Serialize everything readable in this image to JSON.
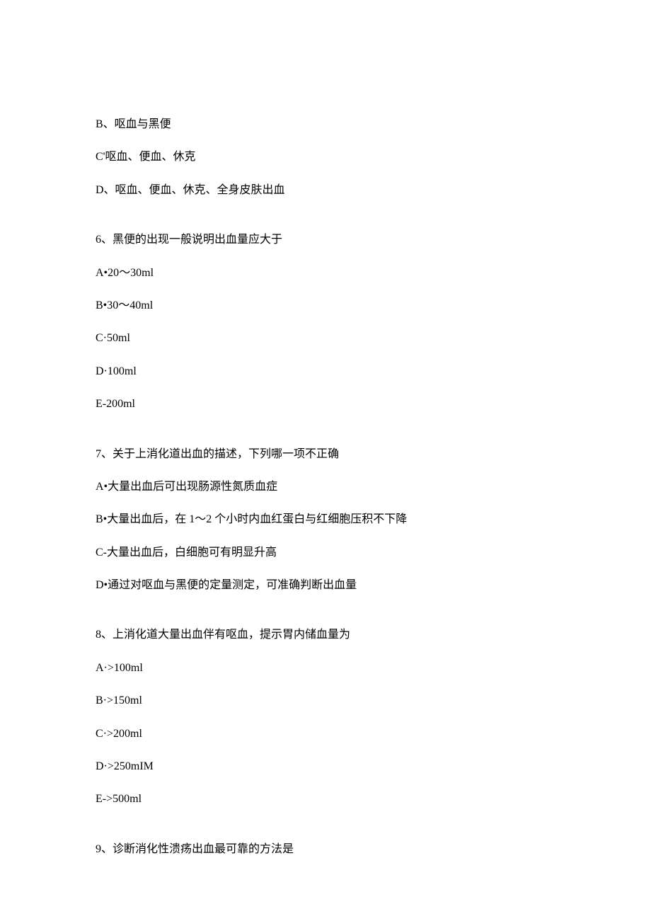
{
  "lines": [
    {
      "text": "B、呕血与黑便",
      "gap": false
    },
    {
      "text": "C'呕血、便血、休克",
      "gap": false
    },
    {
      "text": "D、呕血、便血、休克、全身皮肤出血",
      "gap": false
    },
    {
      "text": "6、黑便的出现一般说明出血量应大于",
      "gap": true
    },
    {
      "text": "A•20～30ml",
      "gap": false
    },
    {
      "text": "B•30～40ml",
      "gap": false
    },
    {
      "text": "C·50ml",
      "gap": false
    },
    {
      "text": "D·100ml",
      "gap": false
    },
    {
      "text": "E-200ml",
      "gap": false
    },
    {
      "text": "7、关于上消化道出血的描述，下列哪一项不正确",
      "gap": true
    },
    {
      "text": "A•大量出血后可出现肠源性氮质血症",
      "gap": false
    },
    {
      "text": "B•大量出血后，在 1～2 个小时内血红蛋白与红细胞压积不下降",
      "gap": false
    },
    {
      "text": "C-大量出血后，白细胞可有明显升高",
      "gap": false
    },
    {
      "text": "D•通过对呕血与黑便的定量测定，可准确判断出血量",
      "gap": false
    },
    {
      "text": "8、上消化道大量出血伴有呕血，提示胃内储血量为",
      "gap": true
    },
    {
      "text": "A·>100ml",
      "gap": false
    },
    {
      "text": "B·>150ml",
      "gap": false
    },
    {
      "text": "C·>200ml",
      "gap": false
    },
    {
      "text": "D·>250mIM",
      "gap": false
    },
    {
      "text": "E->500ml",
      "gap": false
    },
    {
      "text": "9、诊断消化性溃疡出血最可靠的方法是",
      "gap": true
    }
  ]
}
